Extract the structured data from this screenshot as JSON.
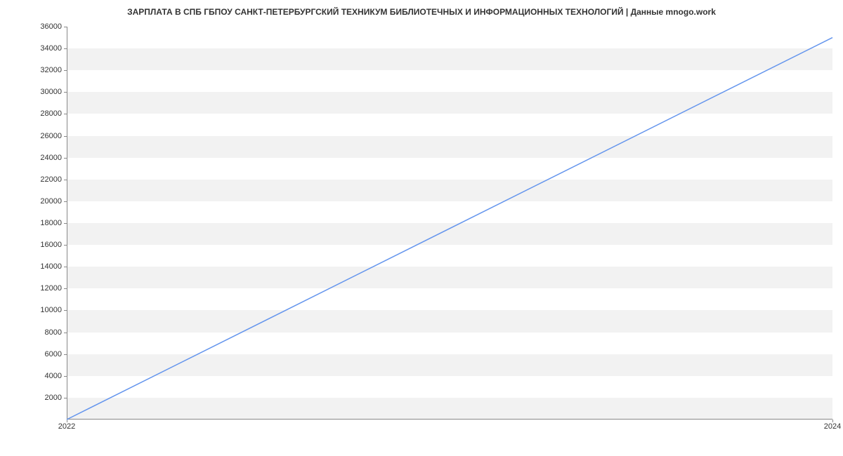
{
  "chart_data": {
    "type": "line",
    "title": "ЗАРПЛАТА В СПБ ГБПОУ САНКТ-ПЕТЕРБУРГСКИЙ ТЕХНИКУМ БИБЛИОТЕЧНЫХ И ИНФОРМАЦИОННЫХ ТЕХНОЛОГИЙ | Данные mnogo.work",
    "x": [
      2022,
      2024
    ],
    "values": [
      0,
      35000
    ],
    "xlabel": "",
    "ylabel": "",
    "xlim": [
      2022,
      2024
    ],
    "ylim": [
      0,
      36000
    ],
    "y_ticks": [
      2000,
      4000,
      6000,
      8000,
      10000,
      12000,
      14000,
      16000,
      18000,
      20000,
      22000,
      24000,
      26000,
      28000,
      30000,
      32000,
      34000,
      36000
    ],
    "x_ticks": [
      2022,
      2024
    ],
    "line_color": "#6495ed"
  }
}
